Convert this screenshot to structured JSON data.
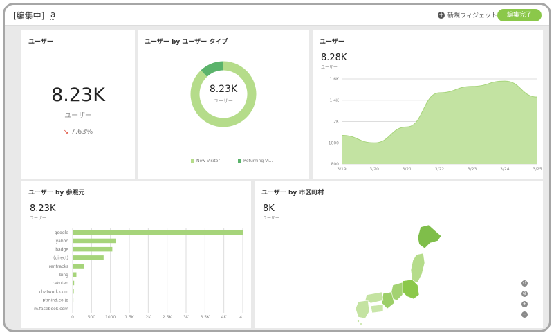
{
  "header": {
    "mode_label": "[編集中]",
    "dashboard_name": "a",
    "add_widget_label": "新規ウィジェット",
    "done_label": "編集完了"
  },
  "colors": {
    "accent": "#8bc84a",
    "light_green": "#b5dc8a",
    "dark_green": "#5bb36b",
    "down": "#e0523f"
  },
  "widget_users": {
    "title": "ユーザー",
    "value": "8.23K",
    "label": "ユーザー",
    "change": "7.63%",
    "change_direction": "down"
  },
  "widget_user_type": {
    "title": "ユーザー by ユーザー タイプ",
    "value": "8.23K",
    "label": "ユーザー",
    "legend": [
      "New Visitor",
      "Returning Vi..."
    ]
  },
  "widget_users_trend": {
    "title": "ユーザー",
    "value": "8.28K",
    "label": "ユーザー"
  },
  "widget_referrer": {
    "title": "ユーザー by 参照元",
    "value": "8.23K",
    "label": "ユーザー"
  },
  "widget_city": {
    "title": "ユーザー by 市区町村",
    "value": "8K",
    "label": "ユーザー"
  },
  "chart_data": [
    {
      "type": "pie",
      "categories": [
        "New Visitor",
        "Returning Vi..."
      ],
      "values": [
        88,
        12
      ],
      "title": "ユーザー by ユーザー タイプ"
    },
    {
      "type": "area",
      "x": [
        "3/19",
        "3/20",
        "3/21",
        "3/22",
        "3/23",
        "3/24",
        "3/25"
      ],
      "y_ticks": [
        "800",
        "1000",
        "1.2K",
        "1.4K",
        "1.6K"
      ],
      "ylim": [
        800,
        1600
      ],
      "series": [
        {
          "values": [
            1070,
            1000,
            1150,
            1470,
            1530,
            1580,
            1430
          ]
        }
      ],
      "grid": true
    },
    {
      "type": "bar",
      "orientation": "horizontal",
      "categories": [
        "google",
        "yahoo",
        "badge",
        "(direct)",
        "rentracks",
        "bing",
        "rakuten",
        "chatwork.com",
        "ptmind.co.jp",
        "m.facebook.com"
      ],
      "values": [
        4500,
        1150,
        1050,
        820,
        300,
        100,
        40,
        30,
        20,
        15
      ],
      "x_ticks": [
        "0",
        "500",
        "1000",
        "1.5K",
        "2K",
        "2.5K",
        "3K",
        "3.5K",
        "4K",
        "4..."
      ],
      "xlim": [
        0,
        4500
      ]
    }
  ]
}
